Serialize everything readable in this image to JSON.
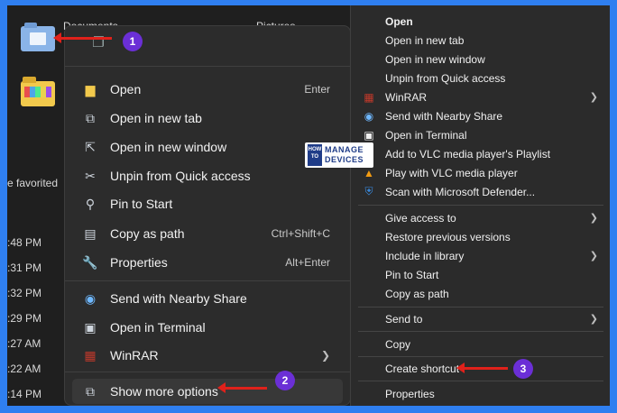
{
  "explorer": {
    "tiles": [
      {
        "label": "Documents"
      },
      {
        "label": "Pictures"
      }
    ],
    "favorited_text": "e favorited",
    "times": ":48 PM|:31 PM|:32 PM|:29 PM|:27 AM|:22 AM|:14 PM",
    "times_list": [
      ":48 PM",
      ":31 PM",
      ":32 PM",
      ":29 PM",
      ":27 AM",
      ":22 AM",
      ":14 PM"
    ]
  },
  "w11_menu": {
    "items": [
      {
        "label": "Open",
        "shortcut": "Enter",
        "icon": "folder-icon"
      },
      {
        "label": "Open in new tab",
        "shortcut": "",
        "icon": "new-tab-icon"
      },
      {
        "label": "Open in new window",
        "shortcut": "",
        "icon": "new-window-icon"
      },
      {
        "label": "Unpin from Quick access",
        "shortcut": "",
        "icon": "unpin-icon"
      },
      {
        "label": "Pin to Start",
        "shortcut": "",
        "icon": "pin-icon"
      },
      {
        "label": "Copy as path",
        "shortcut": "Ctrl+Shift+C",
        "icon": "copy-path-icon"
      },
      {
        "label": "Properties",
        "shortcut": "Alt+Enter",
        "icon": "wrench-icon"
      },
      {
        "label": "Send with Nearby Share",
        "shortcut": "",
        "icon": "nearby-share-icon"
      },
      {
        "label": "Open in Terminal",
        "shortcut": "",
        "icon": "terminal-icon"
      },
      {
        "label": "WinRAR",
        "shortcut": "",
        "icon": "winrar-icon"
      },
      {
        "label": "Show more options",
        "shortcut": "",
        "icon": "more-options-icon"
      }
    ]
  },
  "classic_menu": {
    "items": [
      {
        "label": "Open"
      },
      {
        "label": "Open in new tab"
      },
      {
        "label": "Open in new window"
      },
      {
        "label": "Unpin from Quick access"
      },
      {
        "label": "WinRAR"
      },
      {
        "label": "Send with Nearby Share"
      },
      {
        "label": "Open in Terminal"
      },
      {
        "label": "Add to VLC media player's Playlist"
      },
      {
        "label": "Play with VLC media player"
      },
      {
        "label": "Scan with Microsoft Defender..."
      },
      {
        "label": "Give access to"
      },
      {
        "label": "Restore previous versions"
      },
      {
        "label": "Include in library"
      },
      {
        "label": "Pin to Start"
      },
      {
        "label": "Copy as path"
      },
      {
        "label": "Send to"
      },
      {
        "label": "Copy"
      },
      {
        "label": "Create shortcut"
      },
      {
        "label": "Properties"
      }
    ]
  },
  "annotations": {
    "badge_1": "1",
    "badge_2": "2",
    "badge_3": "3"
  },
  "watermark": {
    "how_to": "HOW TO",
    "line1": "MANAGE",
    "line2": "DEVICES"
  },
  "colors": {
    "border_blue": "#2f7ff0",
    "arrow_red": "#e0211b",
    "badge_purple": "#6b2fd6"
  }
}
